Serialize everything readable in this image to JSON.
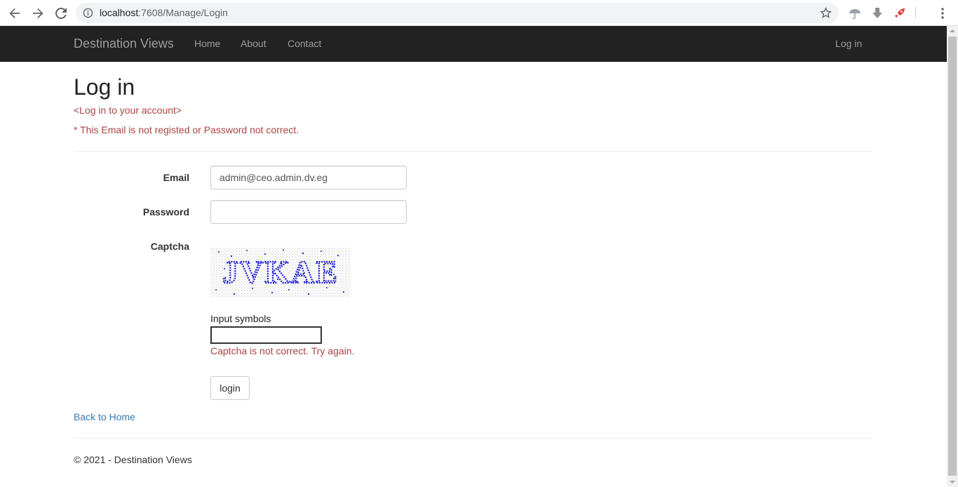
{
  "browser": {
    "url_host": "localhost",
    "url_rest": ":7608/Manage/Login",
    "icons": [
      "back-arrow-icon",
      "forward-arrow-icon",
      "reload-icon",
      "info-icon",
      "star-icon",
      "umbrella-extension-icon",
      "download-icon",
      "rocket-extension-icon",
      "menu-dots-icon"
    ]
  },
  "navbar": {
    "brand": "Destination Views",
    "links": [
      "Home",
      "About",
      "Contact"
    ],
    "right_link": "Log in"
  },
  "page": {
    "title": "Log in",
    "subtitle": "<Log in to your account>",
    "error_summary": "* This Email is not registed or Password not correct."
  },
  "form": {
    "email_label": "Email",
    "email_value": "admin@ceo.admin.dv.eg",
    "password_label": "Password",
    "password_value": "",
    "captcha_label": "Captcha",
    "captcha_text": "JVKAE",
    "captcha_hint": "Input symbols",
    "captcha_value": "",
    "captcha_error": "Captcha is not correct. Try again.",
    "submit_label": "login"
  },
  "back_link": "Back to Home",
  "footer": "© 2021 - Destination Views",
  "colors": {
    "navbar_bg": "#222222",
    "error": "#a94442",
    "link": "#337ab7"
  }
}
